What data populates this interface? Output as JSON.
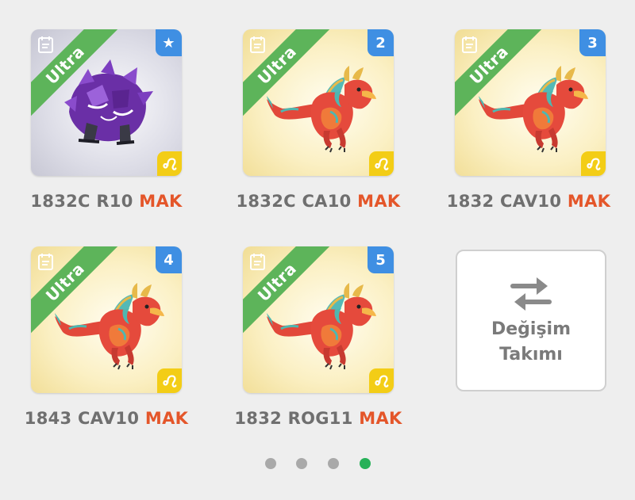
{
  "cards": [
    {
      "tier": "Ultra",
      "badge": "★",
      "creature": "purple-rock-beast",
      "element": "light",
      "name": "1832C R10",
      "status": "MAK"
    },
    {
      "tier": "Ultra",
      "badge": "2",
      "creature": "red-dragon",
      "element": "light",
      "name": "1832C CA10",
      "status": "MAK"
    },
    {
      "tier": "Ultra",
      "badge": "3",
      "creature": "red-dragon",
      "element": "light",
      "name": "1832 CAV10",
      "status": "MAK"
    },
    {
      "tier": "Ultra",
      "badge": "4",
      "creature": "red-dragon",
      "element": "light",
      "name": "1843 CAV10",
      "status": "MAK"
    },
    {
      "tier": "Ultra",
      "badge": "5",
      "creature": "red-dragon",
      "element": "light",
      "name": "1832 ROG11",
      "status": "MAK"
    }
  ],
  "swap_team": {
    "line1": "Değişim",
    "line2": "Takımı",
    "icon": "swap-arrows-icon"
  },
  "pagination": {
    "pages": 4,
    "active": 4
  },
  "colors": {
    "ultra_ribbon": "#5db45a",
    "badge_blue": "#3f8fe3",
    "element_yellow": "#f3cd16",
    "status_orange": "#e4562a",
    "name_gray": "#6f6f6f",
    "dot_active": "#26b158",
    "dot_inactive": "#a9a9a9"
  }
}
